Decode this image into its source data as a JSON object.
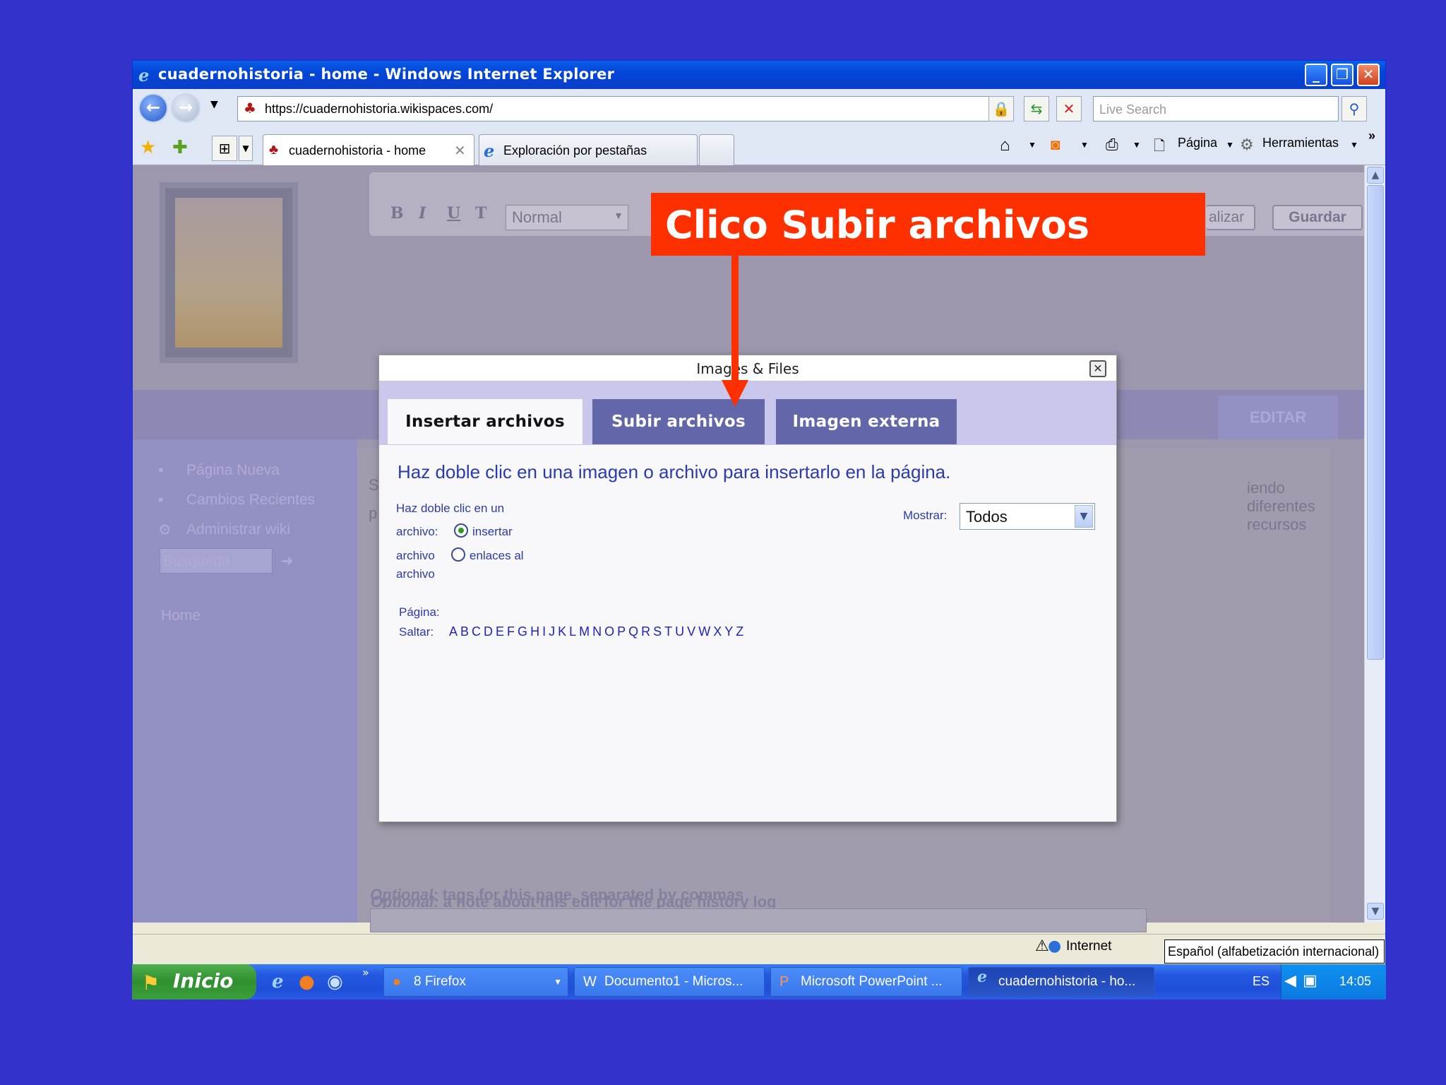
{
  "window": {
    "title": "cuadernohistoria - home - Windows Internet Explorer",
    "buttons": {
      "minimize": "_",
      "maximize": "❐",
      "close": "✕"
    }
  },
  "address": {
    "url": "https://cuadernohistoria.wikispaces.com/",
    "search_placeholder": "Live Search"
  },
  "tabs": [
    {
      "label": "cuadernohistoria - home",
      "active": true
    },
    {
      "label": "Exploración por pestañas",
      "active": false
    }
  ],
  "commandbar": {
    "page": "Página",
    "tools": "Herramientas",
    "more": "»"
  },
  "editor": {
    "format_buttons": [
      "B",
      "I",
      "U",
      "T"
    ],
    "style_select": "Normal",
    "preview_partial": "alizar",
    "save": "Guardar",
    "edit": "EDITAR"
  },
  "left_nav": {
    "items": [
      "Página Nueva",
      "Cambios Recientes",
      "Administrar wiki"
    ],
    "search_placeholder": "Búsqueda",
    "home": "Home"
  },
  "content": {
    "snippet_s": "S",
    "snippet_p": "p",
    "right_text": "iendo diferentes recursos",
    "optional_note_label_em": "Optional:",
    "optional_note_label": " a note about this edit for the page history log",
    "optional_tags_label_em": "Optional:",
    "optional_tags_label": " tags for this page, separated by commas"
  },
  "dialog": {
    "title": "Images & Files",
    "close": "✕",
    "tabs": [
      "Insertar archivos",
      "Subir archivos",
      "Imagen externa"
    ],
    "instruction": "Haz doble clic en una imagen o archivo para insertarlo en la página.",
    "dbl_label_1": "Haz doble clic en un",
    "dbl_label_2": "archivo:",
    "option_insert": "insertar",
    "archivo_label": "archivo",
    "option_link": "enlaces al",
    "option_link_2": "archivo",
    "show_label": "Mostrar:",
    "show_value": "Todos",
    "page_label": "Página:",
    "jump_label": "Saltar:",
    "letters": [
      "A",
      "B",
      "C",
      "D",
      "E",
      "F",
      "G",
      "H",
      "I",
      "J",
      "K",
      "L",
      "M",
      "N",
      "O",
      "P",
      "Q",
      "R",
      "S",
      "T",
      "U",
      "V",
      "W",
      "X",
      "Y",
      "Z"
    ]
  },
  "annotation": {
    "text": "Clico Subir archivos"
  },
  "status": {
    "zone": "Internet",
    "language": "Español (alfabetización internacional)"
  },
  "taskbar": {
    "start": "Inicio",
    "tasks": [
      "8 Firefox",
      "Documento1 - Micros...",
      "Microsoft PowerPoint ...",
      "cuadernohistoria - ho..."
    ],
    "lang": "ES",
    "clock": "14:05"
  },
  "colors": {
    "accent": "#ff3000",
    "dialog_tab": "#6366a8",
    "background": "#3333cc"
  }
}
